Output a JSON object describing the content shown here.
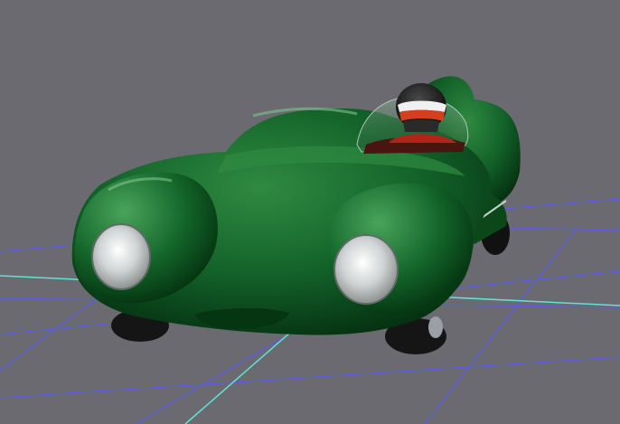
{
  "viewport": {
    "background": "#6a6a70",
    "grid": {
      "visible": true,
      "line_color": "#5a5af0",
      "axis_color": "#5fe3d6"
    }
  },
  "model": {
    "body_color": "#0f5a20",
    "body_highlight": "#3f9a52",
    "body_shadow": "#063510",
    "headlights": 2,
    "wheels_visible": 4,
    "driver_helmet_colors": [
      "#1a1a1a",
      "#d2401c",
      "#f0f0f0"
    ]
  }
}
